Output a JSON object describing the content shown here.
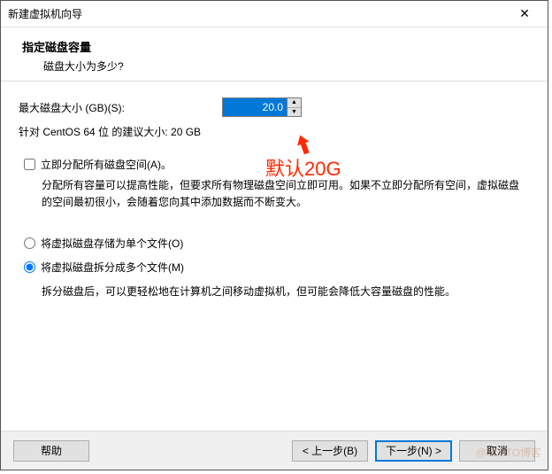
{
  "window": {
    "title": "新建虚拟机向导"
  },
  "header": {
    "title": "指定磁盘容量",
    "sub": "磁盘大小为多少?"
  },
  "size": {
    "label": "最大磁盘大小 (GB)(S):",
    "value": "20.0",
    "recommend": "针对 CentOS 64 位 的建议大小: 20 GB"
  },
  "allocate": {
    "label": "立即分配所有磁盘空间(A)。",
    "desc": "分配所有容量可以提高性能，但要求所有物理磁盘空间立即可用。如果不立即分配所有空间，虚拟磁盘的空间最初很小，会随着您向其中添加数据而不断变大。"
  },
  "storage": {
    "single": "将虚拟磁盘存储为单个文件(O)",
    "split": "将虚拟磁盘拆分成多个文件(M)",
    "split_desc": "拆分磁盘后，可以更轻松地在计算机之间移动虚拟机，但可能会降低大容量磁盘的性能。"
  },
  "footer": {
    "help": "帮助",
    "back": "< 上一步(B)",
    "next": "下一步(N) >",
    "cancel": "取消"
  },
  "annotation": {
    "text": "默认20G"
  },
  "watermark": "@51CTO博客"
}
